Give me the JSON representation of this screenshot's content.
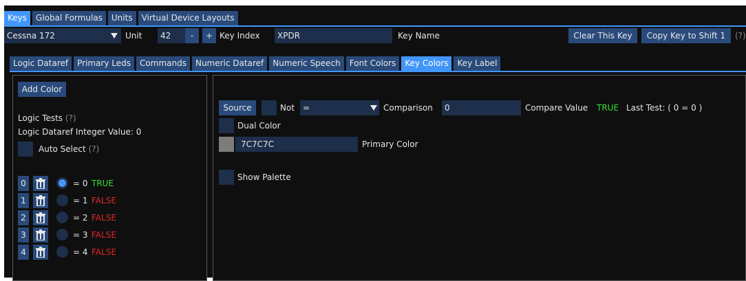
{
  "top_tabs": [
    "Keys",
    "Global Formulas",
    "Units",
    "Virtual Device Layouts"
  ],
  "toolbar": {
    "device": "Cessna 172",
    "unit_label": "Unit",
    "unit_value": "42",
    "minus": "-",
    "plus": "+",
    "key_index_label": "Key Index",
    "key_index_value": "XPDR",
    "key_name_label": "Key Name",
    "clear_key": "Clear This Key",
    "copy_key": "Copy Key to Shift 1",
    "help": "(?)"
  },
  "sub_tabs": [
    "Logic Dataref",
    "Primary Leds",
    "Commands",
    "Numeric Dataref",
    "Numeric Speech",
    "Font Colors",
    "Key Colors",
    "Key Label"
  ],
  "active_sub_tab": "Key Colors",
  "left": {
    "add_color": "Add Color",
    "logic_tests": "Logic Tests",
    "logic_tests_help": "(?)",
    "integer_value": "Logic Dataref Integer Value: 0",
    "auto_select": "Auto Select",
    "auto_select_help": "(?)",
    "rows": [
      {
        "index": "0",
        "eq": "= 0",
        "result": "TRUE",
        "selected": true
      },
      {
        "index": "1",
        "eq": "= 1",
        "result": "FALSE",
        "selected": false
      },
      {
        "index": "2",
        "eq": "= 2",
        "result": "FALSE",
        "selected": false
      },
      {
        "index": "3",
        "eq": "= 3",
        "result": "FALSE",
        "selected": false
      },
      {
        "index": "4",
        "eq": "= 4",
        "result": "FALSE",
        "selected": false
      }
    ]
  },
  "right": {
    "source": "Source",
    "not": "Not",
    "operator": "=",
    "comparison_label": "Comparison",
    "comparison_value": "0",
    "compare_value_label": "Compare Value",
    "compare_result": "TRUE",
    "last_test": "Last Test: ( 0 = 0 )",
    "dual_color": "Dual Color",
    "primary_hex": "7C7C7C",
    "primary_color_label": "Primary Color",
    "show_palette": "Show Palette"
  },
  "colors": {
    "accent": "#4296fa",
    "button": "#294a7a",
    "field": "#1d2f4a",
    "true": "#33e033",
    "false": "#e02828",
    "swatch": "#7c7c7c"
  }
}
